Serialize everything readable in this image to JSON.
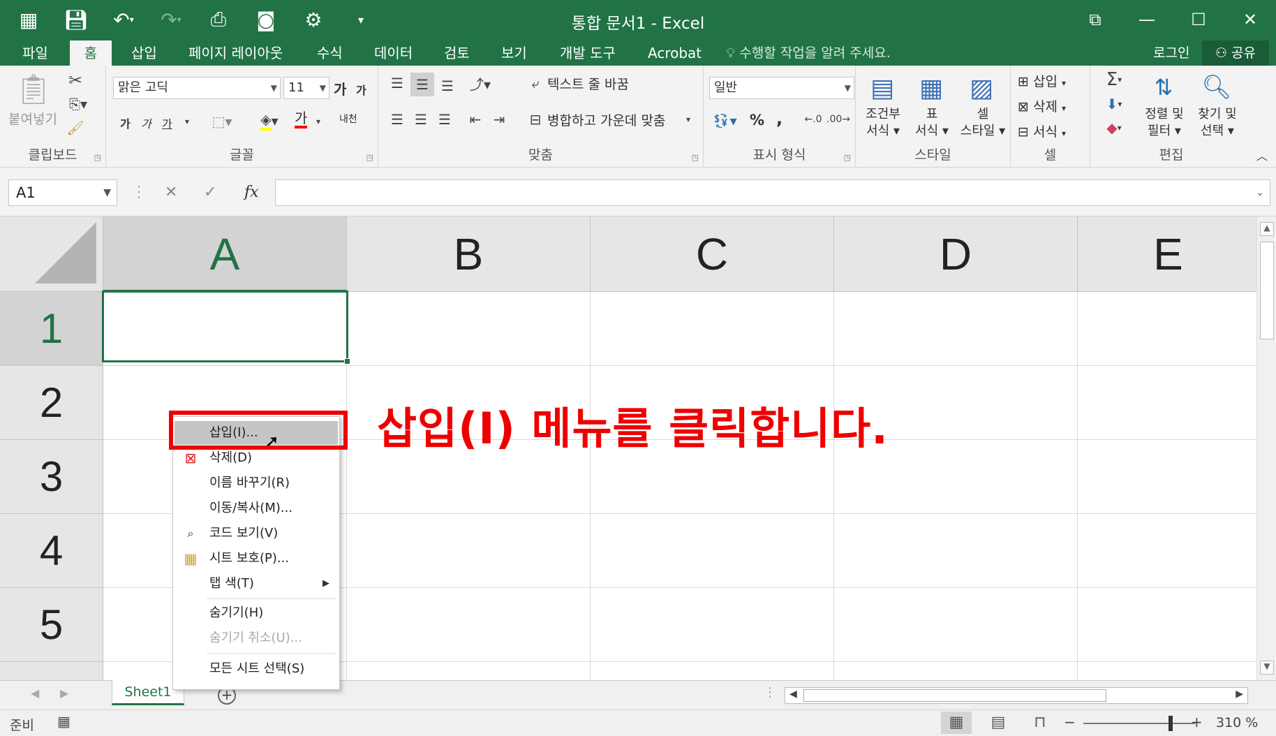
{
  "window": {
    "title": "통합 문서1 - Excel",
    "controls": {
      "restore": "⧉",
      "minimize": "—",
      "maximize": "☐",
      "close": "✕"
    }
  },
  "qat": {
    "icons": [
      "form-icon",
      "save-icon",
      "undo-icon",
      "redo-icon",
      "print-preview-icon",
      "camera-icon",
      "settings-icon",
      "customize-icon"
    ]
  },
  "tabs": [
    "파일",
    "홈",
    "삽입",
    "페이지 레이아웃",
    "수식",
    "데이터",
    "검토",
    "보기",
    "개발 도구",
    "Acrobat"
  ],
  "active_tab": "홈",
  "tell_me": "수행할 작업을 알려 주세요.",
  "account": {
    "login": "로그인",
    "share": "공유"
  },
  "ribbon": {
    "clipboard": {
      "label": "클립보드",
      "paste": "붙여넣기"
    },
    "font": {
      "label": "글꼴",
      "font_name": "맑은 고딕",
      "font_size": "11",
      "grow": "가",
      "shrink": "가",
      "bold": "가",
      "italic": "가",
      "underline": "가",
      "font_color": "가",
      "phonetic": "내천"
    },
    "alignment": {
      "label": "맞춤",
      "wrap_text": "텍스트 줄 바꿈",
      "merge_center": "병합하고 가운데 맞춤"
    },
    "number": {
      "label": "표시 형식",
      "format": "일반",
      "percent": "%",
      "comma": ","
    },
    "styles": {
      "label": "스타일",
      "conditional": [
        "조건부",
        "서식"
      ],
      "table": [
        "표",
        "서식"
      ],
      "cell_styles": [
        "셀",
        "스타일"
      ]
    },
    "cells": {
      "label": "셀",
      "insert": "삽입",
      "delete": "삭제",
      "format": "서식"
    },
    "editing": {
      "label": "편집",
      "sort_filter": [
        "정렬 및",
        "필터"
      ],
      "find_select": [
        "찾기 및",
        "선택"
      ]
    }
  },
  "formula_bar": {
    "name_box": "A1",
    "cancel": "✕",
    "enter": "✓",
    "fx": "fx",
    "value": ""
  },
  "grid": {
    "columns": [
      "A",
      "B",
      "C",
      "D",
      "E"
    ],
    "rows": [
      "1",
      "2",
      "3",
      "4",
      "5"
    ],
    "selected_cell": "A1"
  },
  "context_menu": {
    "items": [
      {
        "label": "삽입(I)...",
        "icon": "",
        "highlighted": true
      },
      {
        "label": "삭제(D)",
        "icon": "delete-sheet-icon"
      },
      {
        "label": "이름 바꾸기(R)",
        "icon": ""
      },
      {
        "label": "이동/복사(M)...",
        "icon": ""
      },
      {
        "label": "코드 보기(V)",
        "icon": "view-code-icon"
      },
      {
        "label": "시트 보호(P)...",
        "icon": "protect-sheet-icon"
      },
      {
        "label": "탭 색(T)",
        "icon": "",
        "submenu": true
      },
      {
        "label": "숨기기(H)",
        "icon": ""
      },
      {
        "label": "숨기기 취소(U)...",
        "icon": "",
        "disabled": true
      },
      {
        "label": "모든 시트 선택(S)",
        "icon": ""
      }
    ]
  },
  "sheet_tabs": {
    "sheets": [
      "Sheet1"
    ],
    "add": "+"
  },
  "status_bar": {
    "ready": "준비",
    "zoom": "310 %",
    "zoom_fraction": 0.78
  },
  "annotation": {
    "text": "삽입(I) 메뉴를 클릭합니다.",
    "color": "#ee0000"
  },
  "colors": {
    "excel_green": "#217346",
    "annotation_red": "#ee0000"
  }
}
